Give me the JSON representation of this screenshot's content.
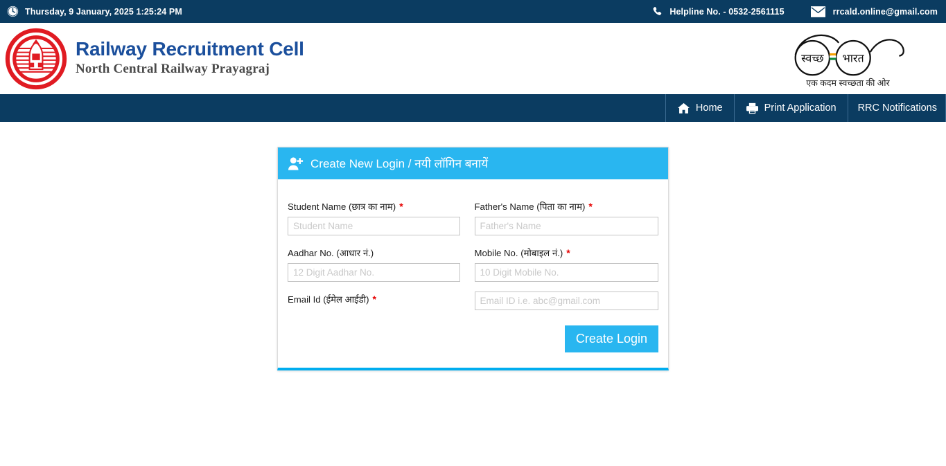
{
  "topbar": {
    "clock_icon": "clock-icon",
    "datetime": "Thursday, 9 January, 2025 1:25:24 PM",
    "phone_icon": "phone-icon",
    "helpline": "Helpline No. - 0532-2561115",
    "mail_icon": "envelope-icon",
    "email": "rrcald.online@gmail.com",
    "bg_color": "#0b3c61"
  },
  "brand": {
    "logo_icon": "indian-railways-emblem",
    "title": "Railway Recruitment Cell",
    "subtitle": "North Central Railway Prayagraj",
    "title_color": "#1b4f9c",
    "swachh": {
      "icon": "swachh-bharat-spectacles-logo",
      "left_lens_text": "स्वच्छ",
      "right_lens_text": "भारत",
      "caption": "एक कदम स्वच्छता की ओर"
    }
  },
  "nav": {
    "bg_color": "#0b3c61",
    "items": [
      {
        "label": "Home",
        "icon": "home-icon"
      },
      {
        "label": "Print Application",
        "icon": "printer-icon"
      },
      {
        "label": "RRC Notifications",
        "icon": "none"
      }
    ]
  },
  "card": {
    "accent_color": "#29b6f0",
    "bottom_border_color": "#00adef",
    "header": {
      "icon": "user-plus-icon",
      "title": "Create New Login / नयी लॉगिन बनायें"
    },
    "fields": {
      "student_name": {
        "label": "Student Name (छात्र का नाम)",
        "required": "*",
        "placeholder": "Student Name",
        "value": ""
      },
      "father_name": {
        "label": "Father's Name (पिता का नाम)",
        "required": "*",
        "placeholder": "Father's Name",
        "value": ""
      },
      "aadhar_no": {
        "label": "Aadhar No. (आधार नं.)",
        "required": "",
        "placeholder": "12 Digit Aadhar No.",
        "value": ""
      },
      "mobile_no": {
        "label": "Mobile No. (मोबाइल नं.)",
        "required": "*",
        "placeholder": "10 Digit Mobile No.",
        "value": ""
      },
      "email_id": {
        "label": "Email Id (ईमेल आईडी)",
        "required": "*",
        "placeholder": "Email ID i.e. abc@gmail.com",
        "value": ""
      }
    },
    "submit_label": "Create Login"
  }
}
